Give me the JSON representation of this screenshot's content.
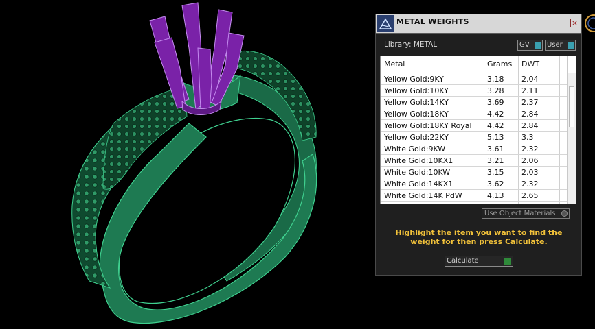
{
  "panel": {
    "title": "METAL WEIGHTS",
    "close_label": "×",
    "library_label": "Library: METAL",
    "gv_label": "GV",
    "user_label": "User",
    "columns": [
      "Metal",
      "Grams",
      "DWT"
    ],
    "rows": [
      {
        "metal": "Yellow Gold:9KY",
        "grams": "3.18",
        "dwt": "2.04"
      },
      {
        "metal": "Yellow Gold:10KY",
        "grams": "3.28",
        "dwt": "2.11"
      },
      {
        "metal": "Yellow Gold:14KY",
        "grams": "3.69",
        "dwt": "2.37"
      },
      {
        "metal": "Yellow Gold:18KY",
        "grams": "4.42",
        "dwt": "2.84"
      },
      {
        "metal": "Yellow Gold:18KY Royal",
        "grams": "4.42",
        "dwt": "2.84"
      },
      {
        "metal": "Yellow Gold:22KY",
        "grams": "5.13",
        "dwt": "3.3"
      },
      {
        "metal": "White Gold:9KW",
        "grams": "3.61",
        "dwt": "2.32"
      },
      {
        "metal": "White Gold:10KX1",
        "grams": "3.21",
        "dwt": "2.06"
      },
      {
        "metal": "White Gold:10KW",
        "grams": "3.15",
        "dwt": "2.03"
      },
      {
        "metal": "White Gold:14KX1",
        "grams": "3.62",
        "dwt": "2.32"
      },
      {
        "metal": "White Gold:14K PdW",
        "grams": "4.13",
        "dwt": "2.65"
      }
    ],
    "use_object_materials_label": "Use Object Materials",
    "instruction": "Highlight the item you want to find the weight for then press Calculate.",
    "calculate_label": "Calculate"
  },
  "colors": {
    "ring_body": "#1e7a52",
    "prongs": "#7a22a8",
    "instruction_text": "#f2c23a",
    "background": "#000000"
  }
}
